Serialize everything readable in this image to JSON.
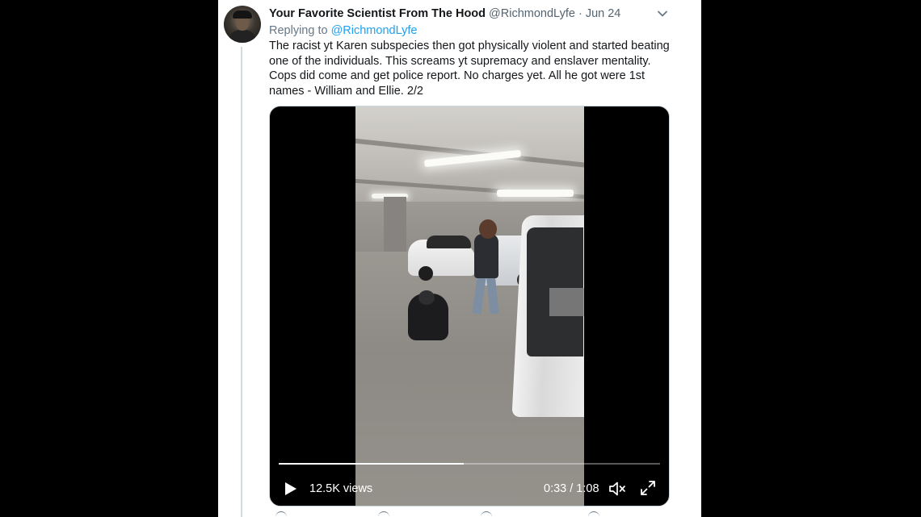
{
  "tweet": {
    "display_name": "Your Favorite Scientist From The Hood",
    "handle": "@RichmondLyfe",
    "separator": "·",
    "date": "Jun 24",
    "reply_prefix": "Replying to",
    "reply_handle": "@RichmondLyfe",
    "body_lines": [
      "The racist yt Karen subspecies then got physically violent and started beating",
      "one of the individuals. This screams yt supremacy and enslaver mentality.",
      "Cops did come and get police report. No charges yet. All he got were 1st",
      "names - William and Ellie. 2/2"
    ]
  },
  "video": {
    "views": "12.5K views",
    "time": "0:33 / 1:08",
    "progress": 0.485
  },
  "icons": {
    "avatar": "avatar",
    "menu": "chevron-down-icon",
    "play": "play-icon",
    "volume": "volume-muted-icon",
    "fullscreen": "fullscreen-icon",
    "actions": [
      "reply-icon",
      "retweet-icon",
      "like-icon",
      "share-icon"
    ]
  },
  "colors": {
    "link": "#1da1f2",
    "muted": "#657786",
    "text": "#14171a"
  }
}
